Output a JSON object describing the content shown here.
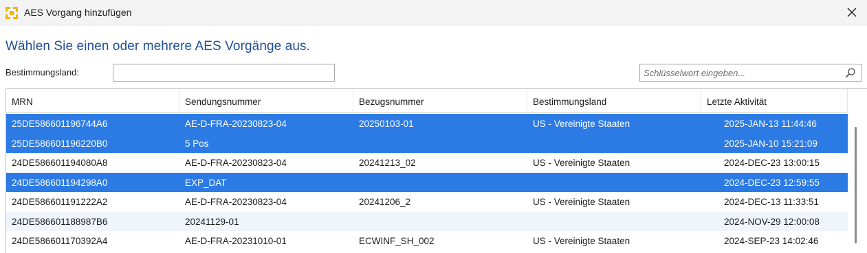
{
  "window": {
    "title": "AES Vorgang hinzufügen",
    "icon": "aes-logo-icon",
    "close": "close-icon"
  },
  "heading": "Wählen Sie einen oder mehrere AES Vorgänge aus.",
  "filter": {
    "label": "Bestimmungsland:",
    "value": ""
  },
  "search": {
    "placeholder": "Schlüsselwort eingeben...",
    "icon": "search-icon"
  },
  "table": {
    "columns": [
      "MRN",
      "Sendungsnummer",
      "Bezugsnummer",
      "Bestimmungsland",
      "Letzte Aktivität"
    ],
    "rows": [
      {
        "mrn": "25DE586601196744A6",
        "send": "AE-D-FRA-20230823-04",
        "bez": "20250103-01",
        "land": "US - Vereinigte Staaten",
        "akt": "2025-JAN-13 11:44:46",
        "selected": true
      },
      {
        "mrn": "25DE586601196220B0",
        "send": "5 Pos",
        "bez": "",
        "land": "",
        "akt": "2025-JAN-10 15:21:09",
        "selected": true
      },
      {
        "mrn": "24DE586601194080A8",
        "send": "AE-D-FRA-20230823-04",
        "bez": "20241213_02",
        "land": "US - Vereinigte Staaten",
        "akt": "2024-DEC-23 13:00:15",
        "selected": false
      },
      {
        "mrn": "24DE586601194298A0",
        "send": "EXP_DAT",
        "bez": "",
        "land": "",
        "akt": "2024-DEC-23 12:59:55",
        "selected": true
      },
      {
        "mrn": "24DE586601191222A2",
        "send": "AE-D-FRA-20230823-04",
        "bez": "20241206_2",
        "land": "US - Vereinigte Staaten",
        "akt": "2024-DEC-13 11:33:51",
        "selected": false
      },
      {
        "mrn": "24DE586601188987B6",
        "send": "20241129-01",
        "bez": "",
        "land": "",
        "akt": "2024-NOV-29 12:00:08",
        "selected": false
      },
      {
        "mrn": "24DE586601170392A4",
        "send": "AE-D-FRA-20231010-01",
        "bez": "ECWINF_SH_002",
        "land": "US - Vereinigte Staaten",
        "akt": "2024-SEP-23 14:02:46",
        "selected": false
      }
    ]
  },
  "colors": {
    "selection": "#2c7be5",
    "heading": "#1f4e96",
    "alt_row": "#f0f4fb"
  }
}
